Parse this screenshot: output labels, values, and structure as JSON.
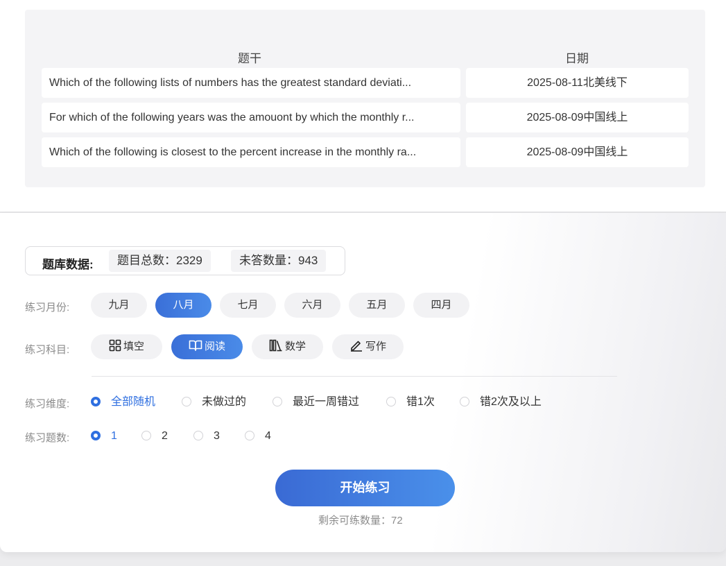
{
  "history": {
    "col_question": "题干",
    "col_date": "日期",
    "rows": [
      {
        "question": "Which of the following lists of numbers has the greatest standard deviati...",
        "date": "2025-08-11北美线下"
      },
      {
        "question": "For which of the following years was the amouont by which the monthly r...",
        "date": "2025-08-09中国线上"
      },
      {
        "question": "Which of the following is closest to the percent increase in the monthly ra...",
        "date": "2025-08-09中国线上"
      }
    ]
  },
  "stats": {
    "label": "题库数据:",
    "total": "题目总数：2329",
    "unanswered": "未答数量：943"
  },
  "months": {
    "label": "练习月份:",
    "options": [
      "九月",
      "八月",
      "七月",
      "六月",
      "五月",
      "四月"
    ],
    "selected": "八月"
  },
  "subjects": {
    "label": "练习科目:",
    "options": [
      {
        "label": "填空",
        "icon": "grid-icon"
      },
      {
        "label": "阅读",
        "icon": "book-icon"
      },
      {
        "label": "数学",
        "icon": "books-icon"
      },
      {
        "label": "写作",
        "icon": "pen-icon"
      }
    ],
    "selected": "阅读"
  },
  "dimension": {
    "label": "练习维度:",
    "options": [
      "全部随机",
      "未做过的",
      "最近一周错过",
      "错1次",
      "错2次及以上"
    ],
    "selected": "全部随机"
  },
  "count": {
    "label": "练习题数:",
    "options": [
      "1",
      "2",
      "3",
      "4"
    ],
    "selected": "1"
  },
  "start_button": "开始练习",
  "remaining": "剩余可练数量：72",
  "colors": {
    "accent": "#2f6fe0",
    "button_start": "#3a6ad4",
    "button_end": "#4a90ea"
  }
}
